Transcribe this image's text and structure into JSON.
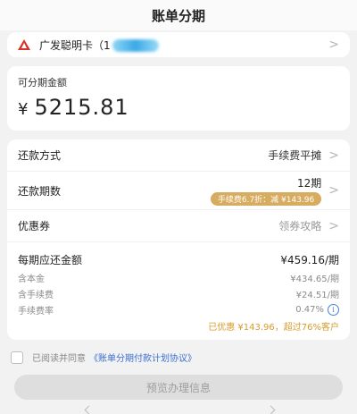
{
  "header": {
    "title": "账单分期"
  },
  "bank": {
    "name": "广发聪明卡（1",
    "logo_icon": "bank-logo-icon"
  },
  "amount": {
    "label": "可分期金额",
    "currency": "¥",
    "value": "5215.81"
  },
  "options": {
    "repay_method_label": "还款方式",
    "repay_method_value": "手续费平摊",
    "term_label": "还款期数",
    "term_value": "12期",
    "term_discount": "手续费6.7折：减 ¥143.96",
    "coupon_label": "优惠券",
    "coupon_value": "领券攻略"
  },
  "summary": {
    "monthly_label": "每期应还金额",
    "monthly_value": "¥459.16/期",
    "principal_label": "含本金",
    "principal_value": "¥434.65/期",
    "fee_label": "含手续费",
    "fee_value": "¥24.51/期",
    "rate_label": "手续费率",
    "rate_value": "0.47%",
    "discount_text": "已优惠 ¥143.96，超过76%客户"
  },
  "agreement": {
    "prefix": "已阅读并同意",
    "link": "《账单分期付款计划协议》"
  },
  "preview_button": {
    "label": "预览办理信息"
  },
  "colors": {
    "accent_gold": "#d8ac60",
    "link_blue": "#3b6fd1",
    "discount_orange": "#d89b2e"
  }
}
